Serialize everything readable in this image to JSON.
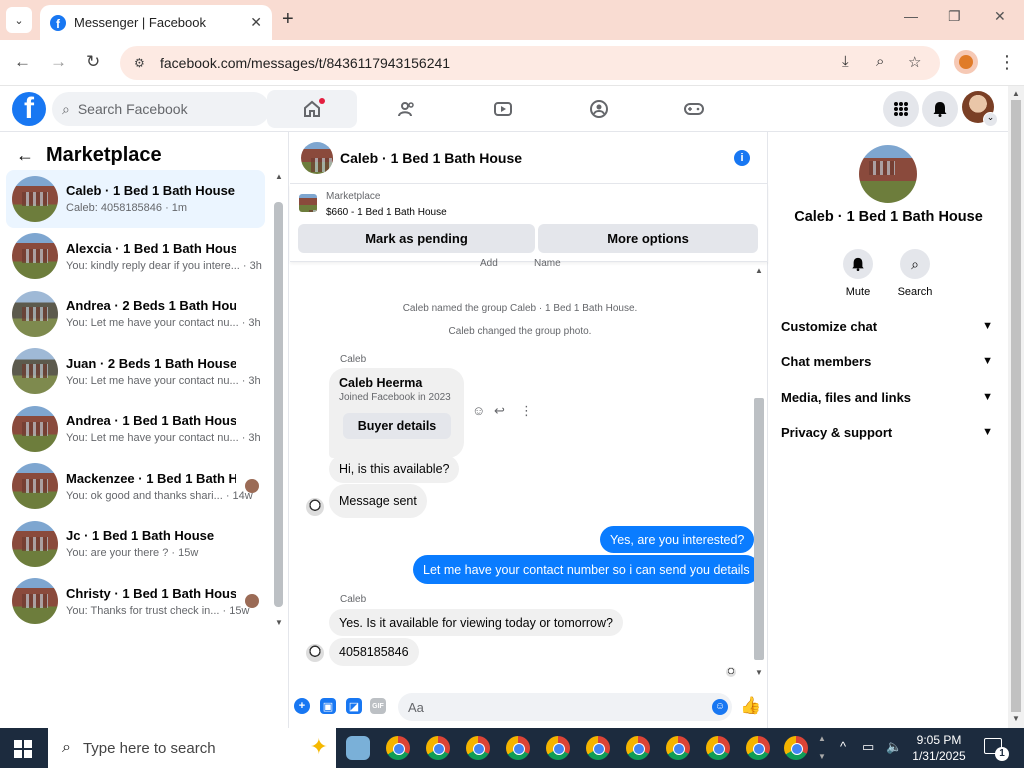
{
  "browser": {
    "tab_title": "Messenger | Facebook",
    "url": "facebook.com/messages/t/8436117943156241"
  },
  "fb": {
    "logo": "f",
    "search_placeholder": "Search Facebook",
    "nav_icons": [
      "home-icon",
      "friends-icon",
      "watch-icon",
      "groups-icon",
      "gaming-icon"
    ],
    "accent": "#1877f2"
  },
  "left": {
    "title": "Marketplace",
    "conversations": [
      {
        "name": "Caleb · 1 Bed 1 Bath House",
        "snippet": "Caleb: 4058185846 · 1m"
      },
      {
        "name": "Alexcia · 1 Bed 1 Bath House",
        "snippet": "You: kindly reply dear if you intere... · 3h"
      },
      {
        "name": "Andrea · 2 Beds 1 Bath House",
        "snippet": "You: Let me have your contact nu... · 3h"
      },
      {
        "name": "Juan · 2 Beds 1 Bath House",
        "snippet": "You: Let me have your contact nu... · 3h"
      },
      {
        "name": "Andrea · 1 Bed 1 Bath House",
        "snippet": "You: Let me have your contact nu... · 3h"
      },
      {
        "name": "Mackenzee · 1 Bed 1 Bath Hous...",
        "snippet": "You: ok good and thanks shari... · 14w"
      },
      {
        "name": "Jc · 1 Bed 1 Bath House",
        "snippet": "You: are your there ? · 15w"
      },
      {
        "name": "Christy · 1 Bed 1 Bath House",
        "snippet": "You: Thanks for trust check in... · 15w"
      }
    ]
  },
  "chat": {
    "title": "Caleb · 1 Bed 1 Bath House",
    "listing_source": "Marketplace",
    "listing_price": "$660 - 1 Bed 1 Bath House",
    "btn_pending": "Mark as pending",
    "btn_more": "More options",
    "cut_labels": [
      "Add",
      "Name"
    ],
    "system_1": "Caleb named the group Caleb · 1 Bed 1 Bath House.",
    "system_2": "Caleb changed the group photo.",
    "sender_1": "Caleb",
    "card_name": "Caleb Heerma",
    "card_joined": "Joined Facebook in 2023",
    "card_button": "Buyer details",
    "msg_1": "Hi, is this available?",
    "msg_2": "Message sent",
    "msg_3": "Yes, are you interested?",
    "msg_4": "Let me have your contact number so i can send you details",
    "sender_2": "Caleb",
    "msg_5": "Yes. Is it available for viewing today or tomorrow?",
    "msg_6": "4058185846",
    "composer_placeholder": "Aa",
    "outgoing_color": "#0a7cff"
  },
  "right": {
    "name": "Caleb · 1 Bed 1 Bath House",
    "mute": "Mute",
    "search": "Search",
    "sections": [
      "Customize chat",
      "Chat members",
      "Media, files and links",
      "Privacy & support"
    ]
  },
  "taskbar": {
    "search_placeholder": "Type here to search",
    "time": "9:05 PM",
    "date": "1/31/2025",
    "notifications": "1"
  }
}
